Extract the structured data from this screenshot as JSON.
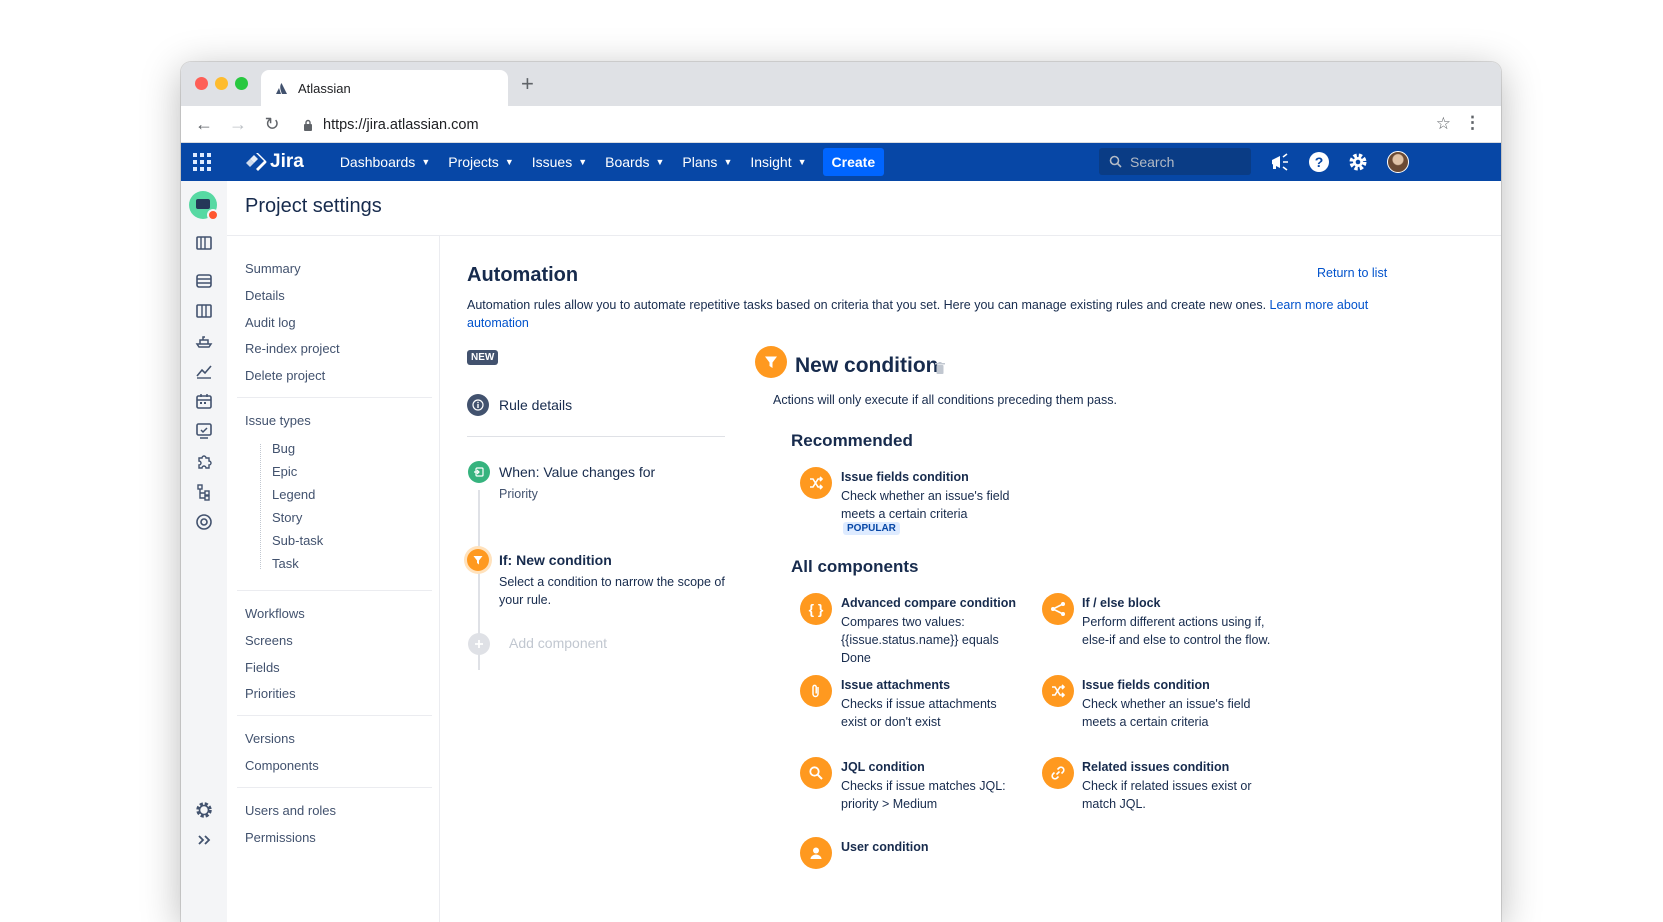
{
  "browser": {
    "tab_title": "Atlassian",
    "new_tab": "+",
    "url": "https://jira.atlassian.com"
  },
  "topnav": {
    "product": "Jira",
    "menu": [
      "Dashboards",
      "Projects",
      "Issues",
      "Boards",
      "Plans",
      "Insight"
    ],
    "create_label": "Create",
    "search_placeholder": "Search",
    "brand_color": "#0747a6"
  },
  "page": {
    "title": "Project settings"
  },
  "sidenav": {
    "group1": [
      "Summary",
      "Details",
      "Audit log",
      "Re-index project",
      "Delete project"
    ],
    "issue_types_label": "Issue types",
    "issue_types": [
      "Bug",
      "Epic",
      "Legend",
      "Story",
      "Sub-task",
      "Task"
    ],
    "group3": [
      "Workflows",
      "Screens",
      "Fields",
      "Priorities"
    ],
    "group4": [
      "Versions",
      "Components"
    ],
    "group5": [
      "Users and roles",
      "Permissions"
    ]
  },
  "automation": {
    "title": "Automation",
    "return_link": "Return to list",
    "description": "Automation rules allow you to automate repetitive tasks based on criteria that you set. Here you can manage existing rules and create new ones. ",
    "learn_more": "Learn more about automation",
    "new_badge": "NEW",
    "rule_details": "Rule details",
    "trigger_title": "When: Value changes for",
    "trigger_sub": "Priority",
    "condition_title": "If: New condition",
    "condition_sub": "Select a condition to narrow the scope of your rule.",
    "add_component": "Add component"
  },
  "condition_panel": {
    "title": "New condition",
    "description": "Actions will only execute if all conditions preceding them pass.",
    "recommended_label": "Recommended",
    "recommended": {
      "name": "Issue fields condition",
      "desc": "Check whether an issue's field meets a certain criteria",
      "badge": "POPULAR"
    },
    "all_label": "All components",
    "components": [
      {
        "name": "Advanced compare condition",
        "desc": "Compares two values: {{issue.status.name}} equals Done",
        "icon": "braces-icon"
      },
      {
        "name": "If / else block",
        "desc": "Perform different actions using if, else-if and else to control the flow.",
        "icon": "branch-icon"
      },
      {
        "name": "Issue attachments",
        "desc": "Checks if issue attachments exist or don't exist",
        "icon": "paperclip-icon"
      },
      {
        "name": "Issue fields condition",
        "desc": "Check whether an issue's field meets a certain criteria",
        "icon": "shuffle-icon"
      },
      {
        "name": "JQL condition",
        "desc": "Checks if issue matches JQL: priority > Medium",
        "icon": "search-icon"
      },
      {
        "name": "Related issues condition",
        "desc": "Check if related issues exist or match JQL.",
        "icon": "link-icon"
      },
      {
        "name": "User condition",
        "desc": "",
        "icon": "user-icon"
      }
    ],
    "accent_color": "#ff991f"
  }
}
